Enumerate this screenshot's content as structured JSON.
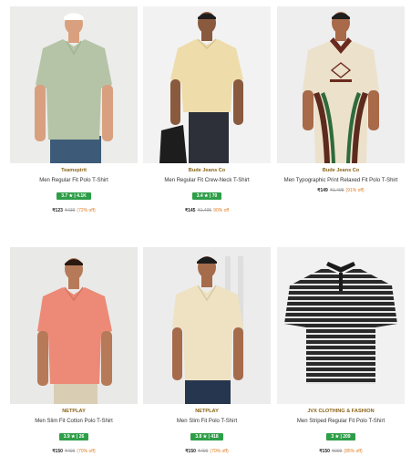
{
  "products": [
    {
      "brand": "Teamspirit",
      "title": "Men Regular Fit Polo T-Shirt",
      "rating": "3.7 ★ | 4.1K",
      "price": "₹123",
      "mrp": "₹439",
      "discount": "(72% off)",
      "colors": {
        "bg": "#f0f0ee",
        "shirt": "#b5c4a7",
        "skin": "#d9a07f",
        "pants": "#3d5b78",
        "accent": "#ffffff"
      }
    },
    {
      "brand": "Bude Jeans Co",
      "title": "Men Regular Fit Crew-Neck T-Shirt",
      "rating": "3.4 ★ | 70",
      "price": "₹145",
      "mrp": "₹1,495",
      "discount": "90% off",
      "colors": {
        "bg": "#f2f2f2",
        "shirt": "#efdcab",
        "skin": "#8a5a3e",
        "pants": "#2d3038",
        "accent": "#1d1d1d"
      }
    },
    {
      "brand": "Bude Jeans Co",
      "title": "Men Typographic Print Relaxed Fit Polo T-Shirt",
      "rating": "",
      "price": "₹149",
      "mrp": "₹1,495",
      "discount": "(91% off)",
      "colors": {
        "bg": "#eeeeee",
        "shirt": "#ece1cb",
        "skin": "#a86a48",
        "pants": "#ece1cb",
        "accent": "#6b2a1e"
      }
    },
    {
      "brand": "NETPLAY",
      "title": "Men Slim Fit Cotton Polo T-Shirt",
      "rating": "3.9 ★ | 26",
      "price": "₹150",
      "mrp": "₹499",
      "discount": "(70% off)",
      "colors": {
        "bg": "#e9e9e7",
        "shirt": "#ec8a77",
        "skin": "#b67a58",
        "pants": "#d9cdb3",
        "accent": "#ec8a77"
      }
    },
    {
      "brand": "NETPLAY",
      "title": "Men Slim Fit Polo T-Shirt",
      "rating": "3.8 ★ | 418",
      "price": "₹150",
      "mrp": "₹499",
      "discount": "(70% off)",
      "colors": {
        "bg": "#ececec",
        "shirt": "#eee2c3",
        "skin": "#a56b4b",
        "pants": "#27364f",
        "accent": "#eee2c3"
      }
    },
    {
      "brand": "JVX CLOTHING & FASHION",
      "title": "Men Striped Regular Fit Polo T-Shirt",
      "rating": "3 ★ | 209",
      "price": "₹150",
      "mrp": "₹999",
      "discount": "(85% off)",
      "colors": {
        "bg": "#f1f1f1",
        "shirt": "#2a2a2a",
        "skin": "#f1f1f1",
        "pants": "#f1f1f1",
        "accent": "#e7e7e7"
      }
    }
  ]
}
